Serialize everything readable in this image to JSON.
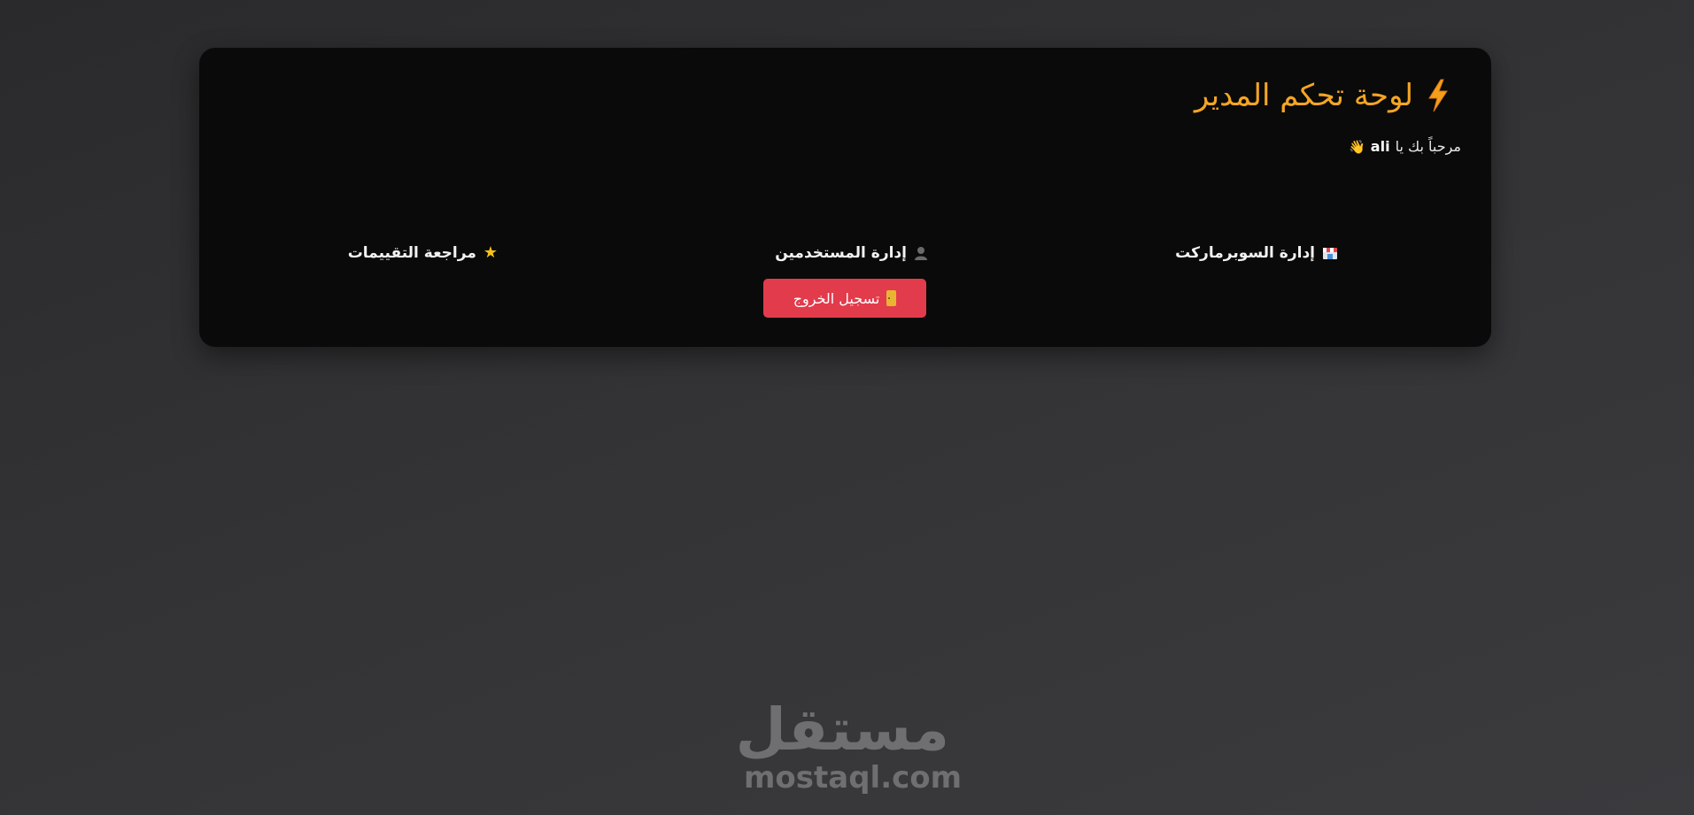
{
  "header": {
    "title": "لوحة تحكم المدير",
    "title_icon": "lightning-bolt-icon",
    "accent_color": "#f5a524"
  },
  "welcome": {
    "prefix": "مرحباً بك يا",
    "username": "ali",
    "icon": "waving-hand-icon"
  },
  "nav": {
    "items": [
      {
        "label": "إدارة السوبرماركت",
        "icon": "store-icon"
      },
      {
        "label": "إدارة المستخدمين",
        "icon": "user-icon"
      },
      {
        "label": "مراجعة التقييمات",
        "icon": "star-icon"
      }
    ]
  },
  "logout": {
    "label": "تسجيل الخروج",
    "icon": "door-icon",
    "color": "#e23b4b"
  },
  "watermark": {
    "arabic": "مستقل",
    "latin": "mostaql.com"
  }
}
